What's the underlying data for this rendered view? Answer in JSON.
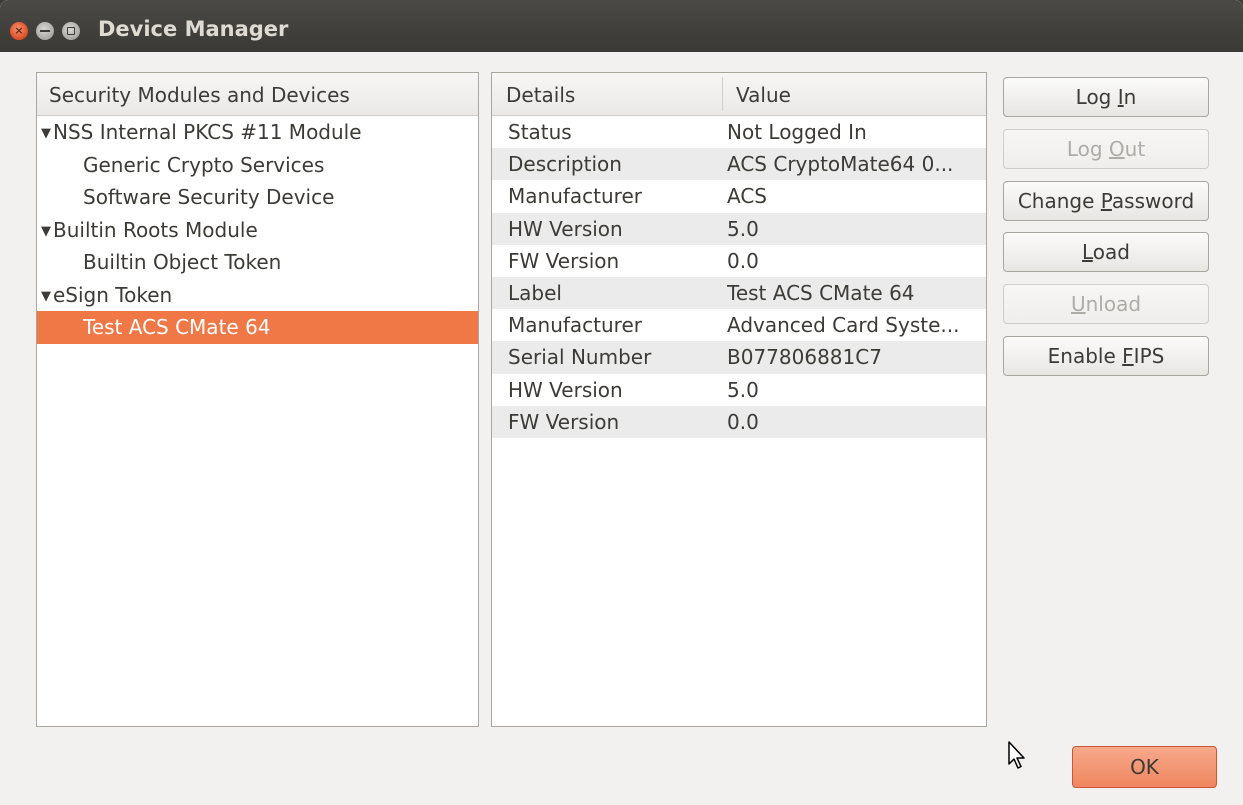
{
  "window": {
    "title": "Device Manager"
  },
  "modules_panel": {
    "header": "Security Modules and Devices",
    "items": [
      {
        "label": "NSS Internal PKCS #11 Module",
        "level": 0,
        "expanded": true
      },
      {
        "label": "Generic Crypto Services",
        "level": 1
      },
      {
        "label": "Software Security Device",
        "level": 1
      },
      {
        "label": "Builtin Roots Module",
        "level": 0,
        "expanded": true
      },
      {
        "label": "Builtin Object Token",
        "level": 1
      },
      {
        "label": "eSign Token",
        "level": 0,
        "expanded": true
      },
      {
        "label": "Test ACS CMate 64",
        "level": 1,
        "selected": true
      }
    ]
  },
  "details_panel": {
    "headers": [
      "Details",
      "Value"
    ],
    "rows": [
      {
        "key": "Status",
        "value": "Not Logged In"
      },
      {
        "key": "Description",
        "value": "ACS CryptoMate64 0..."
      },
      {
        "key": "Manufacturer",
        "value": "ACS"
      },
      {
        "key": "HW Version",
        "value": "5.0"
      },
      {
        "key": "FW Version",
        "value": "0.0"
      },
      {
        "key": "Label",
        "value": "Test ACS CMate 64"
      },
      {
        "key": "Manufacturer",
        "value": "Advanced Card Syste..."
      },
      {
        "key": "Serial Number",
        "value": "B077806881C7"
      },
      {
        "key": "HW Version",
        "value": "5.0"
      },
      {
        "key": "FW Version",
        "value": "0.0"
      }
    ]
  },
  "buttons": {
    "log_in": {
      "pre": "Log ",
      "ul": "I",
      "post": "n",
      "enabled": true
    },
    "log_out": {
      "pre": "Log ",
      "ul": "O",
      "post": "ut",
      "enabled": false
    },
    "change_password": {
      "pre": "Change ",
      "ul": "P",
      "post": "assword",
      "enabled": true
    },
    "load": {
      "pre": "",
      "ul": "L",
      "post": "oad",
      "enabled": true
    },
    "unload": {
      "pre": "",
      "ul": "U",
      "post": "nload",
      "enabled": false
    },
    "enable_fips": {
      "pre": "Enable ",
      "ul": "F",
      "post": "IPS",
      "enabled": true
    }
  },
  "ok_button": {
    "label": "OK"
  },
  "colors": {
    "selection": "#f07746",
    "titlebar": "#3c3b37"
  }
}
